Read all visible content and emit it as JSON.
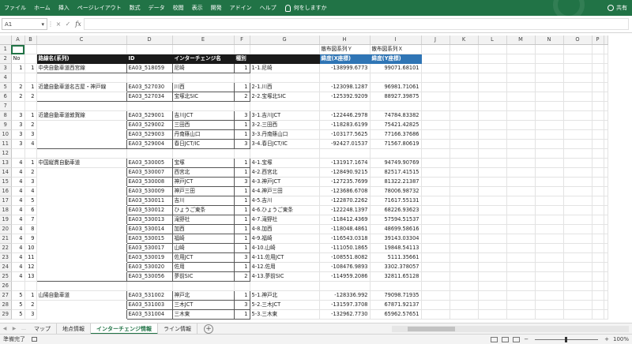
{
  "ribbon": {
    "tabs": [
      "ファイル",
      "ホーム",
      "挿入",
      "ページレイアウト",
      "数式",
      "データ",
      "校閲",
      "表示",
      "開発",
      "アドイン",
      "ヘルプ"
    ],
    "tell_me": "何をしますか",
    "share": "共有"
  },
  "formula_bar": {
    "name_box": "A1",
    "cancel_icon": "×",
    "enter_icon": "✓",
    "fx_label": "fx",
    "formula": ""
  },
  "grid": {
    "columns": [
      "A",
      "B",
      "C",
      "D",
      "E",
      "F",
      "G",
      "H",
      "I",
      "J",
      "K",
      "L",
      "M",
      "N",
      "O",
      "P"
    ],
    "row1": {
      "h": "散布図系列Ｙ",
      "i": "散布図系列Ｘ"
    },
    "header": {
      "a": "No",
      "c": "路線名(系列)",
      "d": "ID",
      "e": "インターチェンジ名",
      "f": "種別",
      "h": "緯度(X座標)",
      "i": "緯度(Y座標)"
    },
    "rows": [
      {
        "r": "3",
        "a": "1",
        "b": "1",
        "c": "中央自動車道西宮線",
        "d": "EA03_518059",
        "e": "尼崎",
        "f": "1",
        "g": "1-1.尼崎",
        "h": "-138999.6773",
        "i": "99071.68101",
        "box": "single"
      },
      {
        "r": "4"
      },
      {
        "r": "5",
        "a": "2",
        "b": "1",
        "c": "近畿自動車道名古屋・神戸線",
        "d": "EA03_527030",
        "e": "川西",
        "f": "1",
        "g": "2-1.川西",
        "h": "-123098.1287",
        "i": "96981.71061",
        "box": "top"
      },
      {
        "r": "6",
        "a": "2",
        "b": "2",
        "c": "",
        "d": "EA03_527034",
        "e": "宝塚北SIC",
        "f": "2",
        "g": "2-2.宝塚北SIC",
        "h": "-125392.9209",
        "i": "88927.39875",
        "box": "bot"
      },
      {
        "r": "7"
      },
      {
        "r": "8",
        "a": "3",
        "b": "1",
        "c": "近畿自動車道敦賀線",
        "d": "EA03_529001",
        "e": "吉川JCT",
        "f": "3",
        "g": "3-1.吉川JCT",
        "h": "-122446.2978",
        "i": "74784.83382",
        "box": "top"
      },
      {
        "r": "9",
        "a": "3",
        "b": "2",
        "c": "",
        "d": "EA03_529002",
        "e": "三田西",
        "f": "1",
        "g": "3-2.三田西",
        "h": "-118283.6199",
        "i": "75421.42825",
        "box": "mid"
      },
      {
        "r": "10",
        "a": "3",
        "b": "3",
        "c": "",
        "d": "EA03_529003",
        "e": "丹南篠山口",
        "f": "1",
        "g": "3-3.丹南篠山口",
        "h": "-103177.5625",
        "i": "77166.37686",
        "box": "mid"
      },
      {
        "r": "11",
        "a": "3",
        "b": "4",
        "c": "",
        "d": "EA03_529004",
        "e": "春日JCT/IC",
        "f": "3",
        "g": "3-4.春日JCT/IC",
        "h": "-92427.01537",
        "i": "71567.80619",
        "box": "bot"
      },
      {
        "r": "12"
      },
      {
        "r": "13",
        "a": "4",
        "b": "1",
        "c": "中国縦貫自動車道",
        "d": "EA03_530005",
        "e": "宝塚",
        "f": "1",
        "g": "4-1.宝塚",
        "h": "-131917.1674",
        "i": "94749.90769",
        "box": "top"
      },
      {
        "r": "14",
        "a": "4",
        "b": "2",
        "c": "",
        "d": "EA03_530007",
        "e": "西宮北",
        "f": "1",
        "g": "4-2.西宮北",
        "h": "-128490.9215",
        "i": "82517.41515",
        "box": "mid"
      },
      {
        "r": "15",
        "a": "4",
        "b": "3",
        "c": "",
        "d": "EA03_530008",
        "e": "神戸JCT",
        "f": "3",
        "g": "4-3.神戸JCT",
        "h": "-127235.7699",
        "i": "81322.21387",
        "box": "mid"
      },
      {
        "r": "16",
        "a": "4",
        "b": "4",
        "c": "",
        "d": "EA03_530009",
        "e": "神戸三田",
        "f": "1",
        "g": "4-4.神戸三田",
        "h": "-123686.6708",
        "i": "78006.98732",
        "box": "mid"
      },
      {
        "r": "17",
        "a": "4",
        "b": "5",
        "c": "",
        "d": "EA03_530011",
        "e": "吉川",
        "f": "1",
        "g": "4-5.吉川",
        "h": "-122870.2262",
        "i": "71617.55131",
        "box": "mid"
      },
      {
        "r": "18",
        "a": "4",
        "b": "6",
        "c": "",
        "d": "EA03_530012",
        "e": "ひょうご東条",
        "f": "1",
        "g": "4-6.ひょうご東条",
        "h": "-122248.1397",
        "i": "68226.93623",
        "box": "mid"
      },
      {
        "r": "19",
        "a": "4",
        "b": "7",
        "c": "",
        "d": "EA03_530013",
        "e": "滝野社",
        "f": "1",
        "g": "4-7.滝野社",
        "h": "-118412.4369",
        "i": "57594.51537",
        "box": "mid"
      },
      {
        "r": "20",
        "a": "4",
        "b": "8",
        "c": "",
        "d": "EA03_530014",
        "e": "加西",
        "f": "1",
        "g": "4-8.加西",
        "h": "-118048.4861",
        "i": "48699.58616",
        "box": "mid"
      },
      {
        "r": "21",
        "a": "4",
        "b": "9",
        "c": "",
        "d": "EA03_530015",
        "e": "福崎",
        "f": "1",
        "g": "4-9.福崎",
        "h": "-116543.0318",
        "i": "39143.03304",
        "box": "mid"
      },
      {
        "r": "22",
        "a": "4",
        "b": "10",
        "c": "",
        "d": "EA03_530017",
        "e": "山崎",
        "f": "1",
        "g": "4-10.山崎",
        "h": "-111050.1865",
        "i": "19848.54113",
        "box": "mid"
      },
      {
        "r": "23",
        "a": "4",
        "b": "11",
        "c": "",
        "d": "EA03_530019",
        "e": "佐用JCT",
        "f": "3",
        "g": "4-11.佐用JCT",
        "h": "-108551.8082",
        "i": "5111.35661",
        "box": "mid"
      },
      {
        "r": "24",
        "a": "4",
        "b": "12",
        "c": "",
        "d": "EA03_530020",
        "e": "佐用",
        "f": "1",
        "g": "4-12.佐用",
        "h": "-108476.9893",
        "i": "3302.378057",
        "box": "mid"
      },
      {
        "r": "25",
        "a": "4",
        "b": "13",
        "c": "",
        "d": "EA03_530056",
        "e": "夢前SIC",
        "f": "2",
        "g": "4-13.夢前SIC",
        "h": "-114959.2086",
        "i": "32811.65128",
        "box": "bot"
      },
      {
        "r": "26"
      },
      {
        "r": "27",
        "a": "5",
        "b": "1",
        "c": "山陽自動車道",
        "d": "EA03_531002",
        "e": "神戸北",
        "f": "1",
        "g": "5-1.神戸北",
        "h": "-128336.992",
        "i": "79098.71935",
        "box": "top"
      },
      {
        "r": "28",
        "a": "5",
        "b": "2",
        "c": "",
        "d": "EA03_531003",
        "e": "三木JCT",
        "f": "3",
        "g": "5-2.三木JCT",
        "h": "-131597.3708",
        "i": "67871.92137",
        "box": "mid"
      },
      {
        "r": "29",
        "a": "5",
        "b": "3",
        "c": "",
        "d": "EA03_531004",
        "e": "三木東",
        "f": "1",
        "g": "5-3.三木東",
        "h": "-132962.7730",
        "i": "65962.57651",
        "box": "mid"
      }
    ]
  },
  "sheets": {
    "tabs": [
      "マップ",
      "地点情報",
      "インターチェンジ情報",
      "ライン情報"
    ],
    "active": 2
  },
  "status": {
    "ready": "準備完了",
    "zoom": "100%"
  }
}
